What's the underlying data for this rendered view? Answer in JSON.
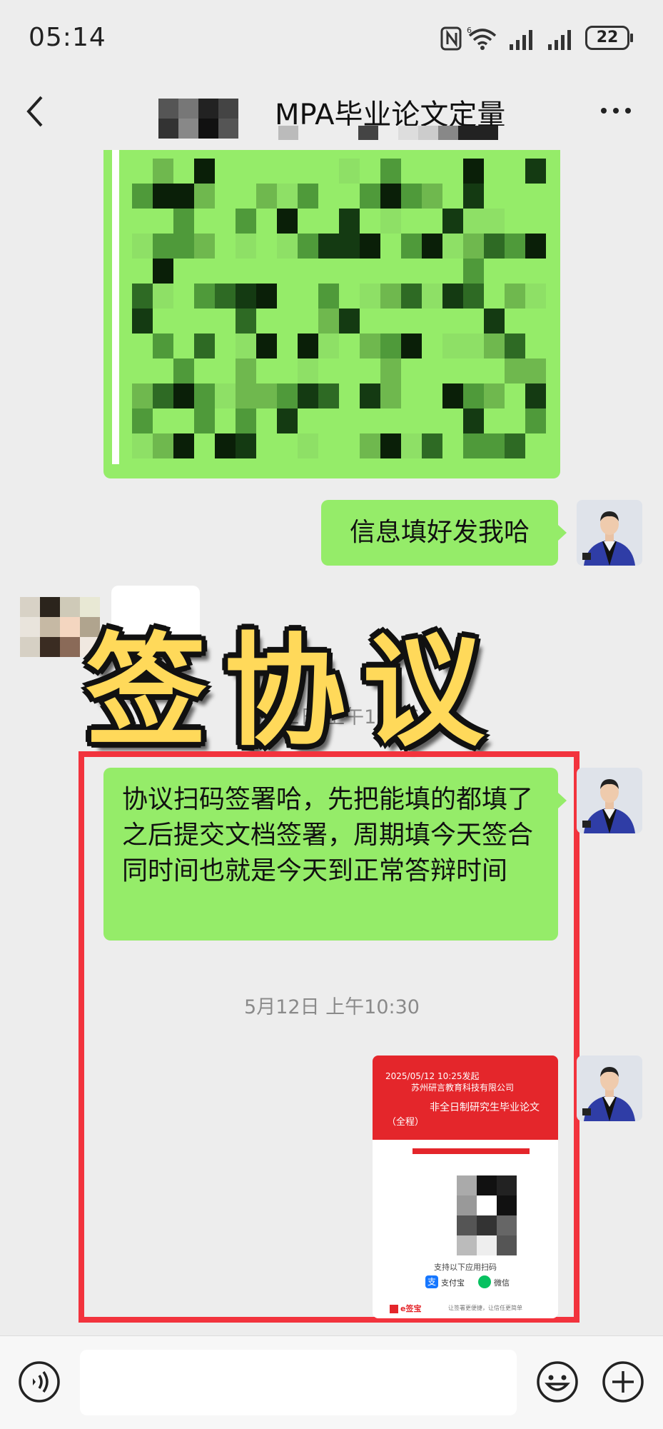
{
  "status_bar": {
    "time": "05:14",
    "battery": "22"
  },
  "header": {
    "title": "MPA毕业论文定量"
  },
  "messages": {
    "msg1": "信息填好发我哈",
    "timestamp1": "5月12日 上午10:26",
    "msg2": "协议扫码签署哈，先把能填的都填了之后提交文档签署，周期填今天签合同时间也就是今天到正常答辩时间",
    "timestamp2": "5月12日 上午10:30"
  },
  "overlay": {
    "text": "签协议"
  },
  "contract_card": {
    "date": "2025/05/12 10:25发起",
    "company": "苏州研言教育科技有限公司",
    "title": "非全日制研究生毕业论文",
    "subtitle": "（全程）",
    "support_text": "支持以下应用扫码",
    "apps": [
      "支付宝",
      "微信"
    ],
    "footer_brand": "e签宝",
    "footer_text": "让签署更便捷，让信任更简单"
  },
  "icons": {
    "back": "chevron-left-icon",
    "more": "more-dots-icon",
    "voice": "voice-icon",
    "emoji": "emoji-icon",
    "plus": "plus-icon"
  },
  "colors": {
    "bubble_green": "#95ec69",
    "highlight_red": "#f2333d",
    "overlay_yellow": "#ffd95a",
    "card_red": "#e4262b"
  }
}
